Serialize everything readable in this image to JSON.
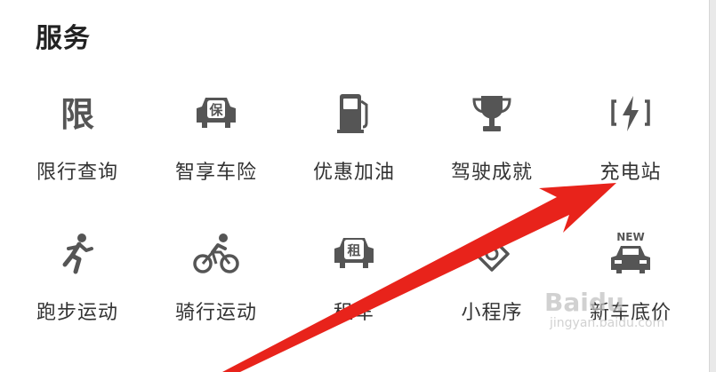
{
  "section": {
    "title": "服务"
  },
  "services": [
    {
      "label": "限行查询",
      "icon": "restriction-icon",
      "glyph": "限"
    },
    {
      "label": "智享车险",
      "icon": "car-insurance-icon",
      "glyph": "保"
    },
    {
      "label": "优惠加油",
      "icon": "fuel-pump-icon"
    },
    {
      "label": "驾驶成就",
      "icon": "trophy-icon"
    },
    {
      "label": "充电站",
      "icon": "charging-station-icon"
    },
    {
      "label": "跑步运动",
      "icon": "running-icon"
    },
    {
      "label": "骑行运动",
      "icon": "cycling-icon"
    },
    {
      "label": "租车",
      "icon": "car-rental-icon",
      "glyph": "租"
    },
    {
      "label": "小程序",
      "icon": "mini-program-icon"
    },
    {
      "label": "新车底价",
      "icon": "new-car-price-icon",
      "glyph": "NEW"
    }
  ],
  "watermark": {
    "brand": "Baidu",
    "site": "jingyan.baidu.com"
  },
  "colors": {
    "icon": "#555555",
    "text": "#333333",
    "arrow": "#e8231b"
  }
}
